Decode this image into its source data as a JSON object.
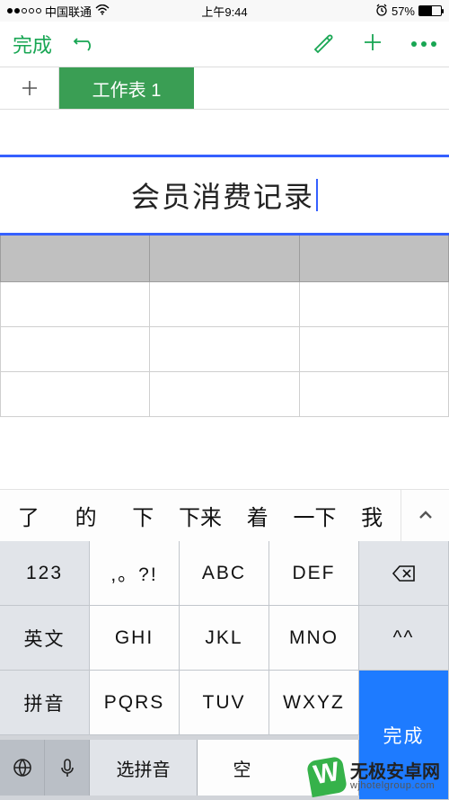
{
  "status": {
    "carrier": "中国联通",
    "time": "上午9:44",
    "battery_pct": "57%",
    "alarm": "⏰"
  },
  "toolbar": {
    "done": "完成"
  },
  "tabs": {
    "sheet1": "工作表 1"
  },
  "cell": {
    "value": "会员消费记录"
  },
  "candidates": [
    "了",
    "的",
    "下",
    "下来",
    "着",
    "一下",
    "我"
  ],
  "keys": {
    "r1c1": "123",
    "r1c2": ",。?!",
    "r1c3": "ABC",
    "r1c4": "DEF",
    "r2c1": "英文",
    "r2c2": "GHI",
    "r2c3": "JKL",
    "r2c4": "MNO",
    "r2c5": "^^",
    "r3c1": "拼音",
    "r3c2": "PQRS",
    "r3c3": "TUV",
    "r3c4": "WXYZ",
    "r3c5": "完成",
    "select_pinyin": "选拼音",
    "space": "空"
  },
  "watermark": {
    "line1": "无极安卓网",
    "line2": "wjhotelgroup.com"
  }
}
